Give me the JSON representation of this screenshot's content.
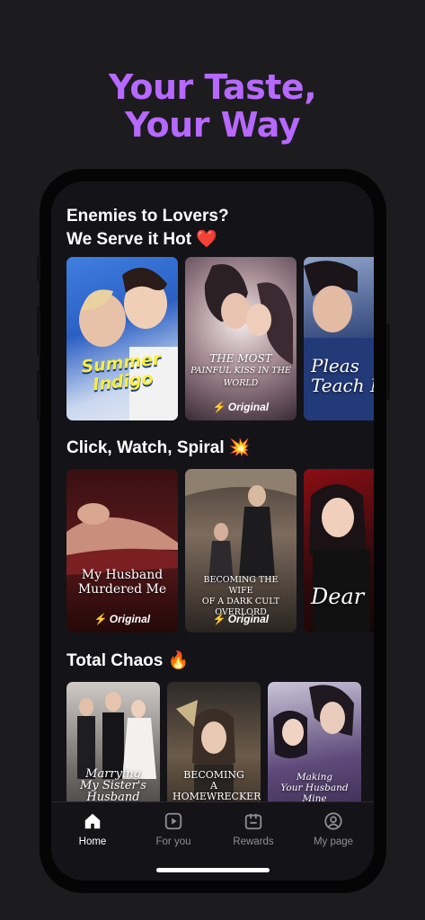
{
  "promo": {
    "headline_line1": "Your Taste,",
    "headline_line2": "Your Way",
    "accent_color": "#b768ff"
  },
  "sections": [
    {
      "title": "Enemies to Lovers?",
      "title_line2": "We Serve it Hot",
      "emoji": "❤️",
      "cards": [
        {
          "title_line1": "Summer",
          "title_line2": "Indigo",
          "badge": ""
        },
        {
          "title_line1": "THE MOST",
          "title_line2": "PAINFUL KISS IN THE WORLD",
          "badge": "Original"
        },
        {
          "title_line1": "Pleas",
          "title_line2": "Teach M",
          "badge": ""
        }
      ]
    },
    {
      "title": "Click, Watch, Spiral",
      "emoji": "💥",
      "cards": [
        {
          "title_line1": "My Husband",
          "title_line2": "Murdered Me",
          "badge": "Original"
        },
        {
          "title_line1": "BECOMING THE WIFE",
          "title_line2": "OF A DARK CULT OVERLORD",
          "badge": "Original"
        },
        {
          "title_line1": "Dear",
          "title_line2": "",
          "badge": ""
        }
      ]
    },
    {
      "title": "Total Chaos",
      "emoji": "🔥",
      "cards": [
        {
          "title_line1": "Marrying",
          "title_line2": "My Sister's Husband"
        },
        {
          "title_line1": "BECOMING",
          "title_line2": "A HOMEWRECKER"
        },
        {
          "title_line1": "Making",
          "title_line2": "Your Husband Mine"
        }
      ]
    }
  ],
  "tabbar": [
    {
      "label": "Home",
      "icon": "home-icon",
      "active": true
    },
    {
      "label": "For you",
      "icon": "play-icon",
      "active": false
    },
    {
      "label": "Rewards",
      "icon": "gift-icon",
      "active": false
    },
    {
      "label": "My page",
      "icon": "user-icon",
      "active": false
    }
  ]
}
